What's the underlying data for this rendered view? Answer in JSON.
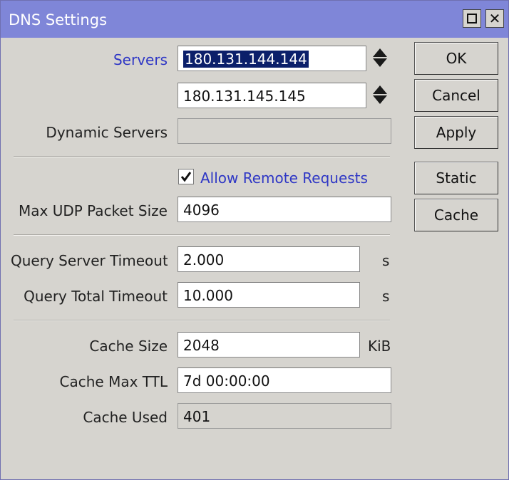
{
  "window": {
    "title": "DNS Settings"
  },
  "titlebar": {
    "maximize_icon": "maximize-icon",
    "close_icon": "close-icon",
    "close_glyph": "✕"
  },
  "form": {
    "servers_label": "Servers",
    "server1": "180.131.144.144",
    "server2": "180.131.145.145",
    "dynamic_servers_label": "Dynamic Servers",
    "dynamic_servers": "",
    "allow_remote_label": "Allow Remote Requests",
    "allow_remote_checked": true,
    "max_udp_label": "Max UDP Packet Size",
    "max_udp": "4096",
    "query_server_timeout_label": "Query Server Timeout",
    "query_server_timeout": "2.000",
    "query_server_timeout_unit": "s",
    "query_total_timeout_label": "Query Total Timeout",
    "query_total_timeout": "10.000",
    "query_total_timeout_unit": "s",
    "cache_size_label": "Cache Size",
    "cache_size": "2048",
    "cache_size_unit": "KiB",
    "cache_max_ttl_label": "Cache Max TTL",
    "cache_max_ttl": "7d 00:00:00",
    "cache_used_label": "Cache Used",
    "cache_used": "401"
  },
  "buttons": {
    "ok": "OK",
    "cancel": "Cancel",
    "apply": "Apply",
    "static": "Static",
    "cache": "Cache"
  },
  "colors": {
    "titlebar": "#7f86d8",
    "label_accent": "#2f37c5",
    "selection": "#0b1f6a"
  }
}
